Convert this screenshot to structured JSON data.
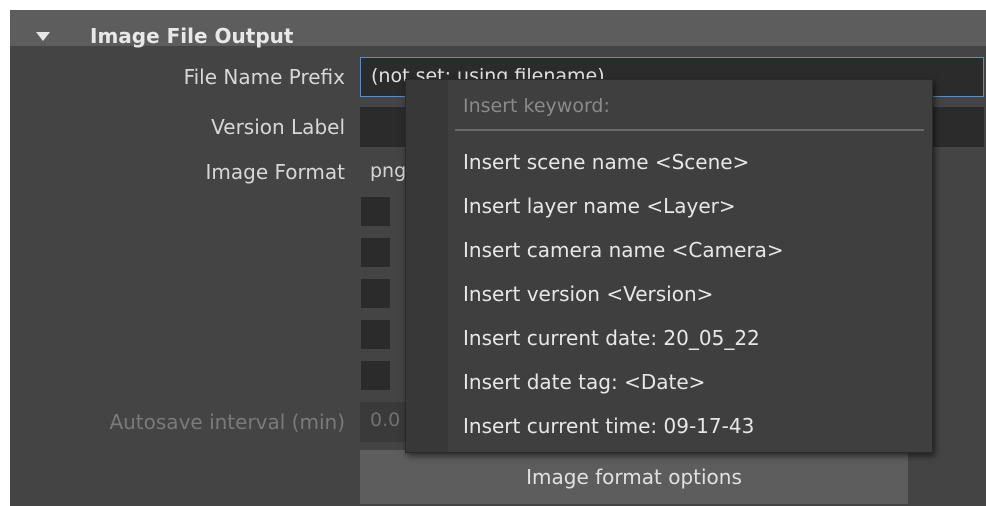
{
  "section": {
    "title": "Image File Output"
  },
  "fields": {
    "file_name_prefix_label": "File Name Prefix",
    "file_name_prefix_value": "(not set; using filename)",
    "version_label_label": "Version Label",
    "version_label_value": "",
    "image_format_label": "Image Format",
    "image_format_value": "png",
    "autosave_label": "Autosave interval (min)",
    "autosave_value": "0.0"
  },
  "buttons": {
    "image_format_options": "Image format options"
  },
  "popup": {
    "title": "Insert keyword:",
    "items": [
      "Insert scene name <Scene>",
      "Insert layer name <Layer>",
      "Insert camera name <Camera>",
      "Insert version <Version>",
      "Insert current date: 20_05_22",
      "Insert date tag: <Date>",
      "Insert current time: 09-17-43"
    ]
  },
  "colors": {
    "panel_bg": "#444444",
    "header_bg": "#5d5d5d",
    "field_bg": "#2b2b2b",
    "focus_border": "#5a8cc7",
    "popup_bg": "#3f3f3f"
  }
}
